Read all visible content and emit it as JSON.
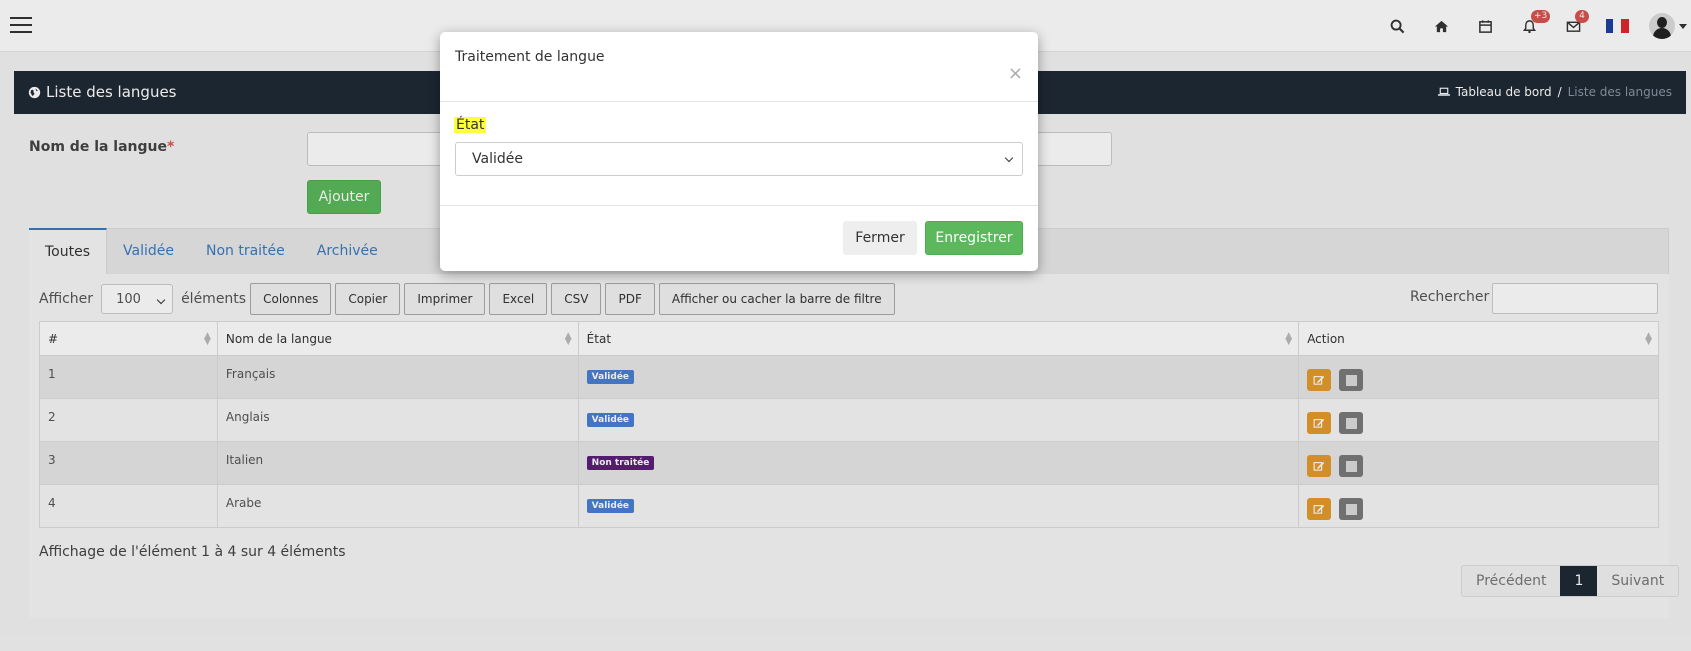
{
  "navbar": {
    "notif_count": "+3",
    "mail_count": "4"
  },
  "header": {
    "title": "Liste des langues",
    "breadcrumb_home": "Tableau de bord",
    "breadcrumb_sep": "/",
    "breadcrumb_current": "Liste des langues"
  },
  "form": {
    "name_label": "Nom de la langue",
    "required_mark": "*",
    "add_button": "Ajouter"
  },
  "tabs": [
    {
      "label": "Toutes"
    },
    {
      "label": "Validée"
    },
    {
      "label": "Non traitée"
    },
    {
      "label": "Archivée"
    }
  ],
  "toolbar": {
    "show_label": "Afficher",
    "page_length": "100",
    "elements_label": "éléments",
    "buttons": [
      "Colonnes",
      "Copier",
      "Imprimer",
      "Excel",
      "CSV",
      "PDF",
      "Afficher ou cacher la barre de filtre"
    ],
    "search_label": "Rechercher :"
  },
  "table": {
    "columns": [
      "#",
      "Nom de la langue",
      "État",
      "Action"
    ],
    "rows": [
      {
        "id": "1",
        "name": "Français",
        "status": "Validée",
        "status_kind": "validated"
      },
      {
        "id": "2",
        "name": "Anglais",
        "status": "Validée",
        "status_kind": "validated"
      },
      {
        "id": "3",
        "name": "Italien",
        "status": "Non traitée",
        "status_kind": "pending"
      },
      {
        "id": "4",
        "name": "Arabe",
        "status": "Validée",
        "status_kind": "validated"
      }
    ]
  },
  "footer": {
    "info": "Affichage de l'élément 1 à 4 sur 4 éléments",
    "prev": "Précédent",
    "page": "1",
    "next": "Suivant"
  },
  "modal": {
    "title": "Traitement de langue",
    "close_glyph": "×",
    "state_label": "État",
    "state_value": "Validée",
    "cancel_button": "Fermer",
    "save_button": "Enregistrer"
  },
  "colors": {
    "success": "#5cb85c",
    "dark": "#1f2a36",
    "link": "#3a7bbf",
    "highlight": "#ffff3a"
  }
}
